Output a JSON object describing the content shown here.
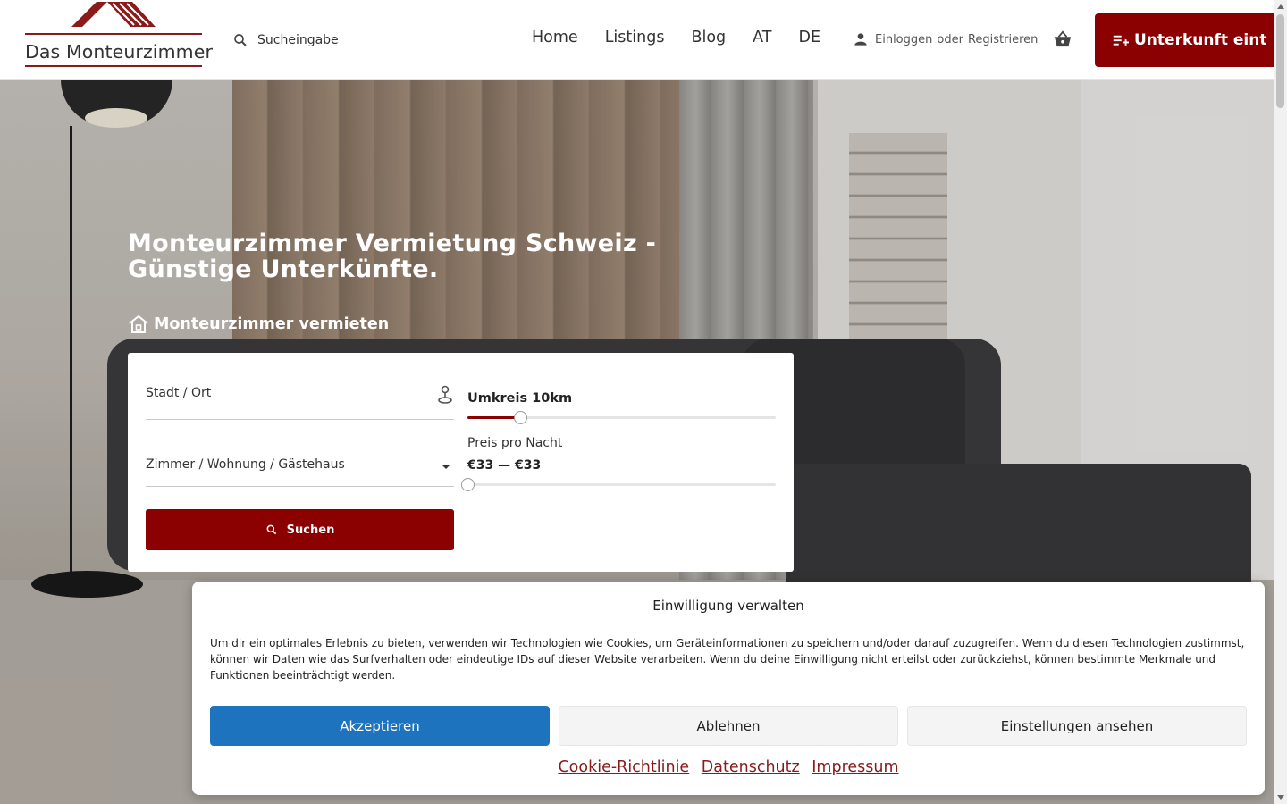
{
  "header": {
    "logo_text": "Das Monteurzimmer",
    "search_placeholder": "Sucheingabe",
    "nav": [
      "Home",
      "Listings",
      "Blog",
      "AT",
      "DE"
    ],
    "login": "Einloggen",
    "or": "oder",
    "register": "Registrieren",
    "cta": "Unterkunft eint"
  },
  "hero": {
    "title": "Monteurzimmer Vermietung Schweiz - Günstige Unterkünfte.",
    "rent_link": "Monteurzimmer vermieten"
  },
  "search_form": {
    "city_label": "Stadt / Ort",
    "type_label": "Zimmer / Wohnung / Gästehaus",
    "radius_label": "Umkreis 10km",
    "radius_fraction": 0.17,
    "price_label": "Preis pro Nacht",
    "price_range": "€33 — €33",
    "price_fraction": 0,
    "search_button": "Suchen"
  },
  "consent": {
    "title": "Einwilligung verwalten",
    "text": "Um dir ein optimales Erlebnis zu bieten, verwenden wir Technologien wie Cookies, um Geräteinformationen zu speichern und/oder darauf zuzugreifen. Wenn du diesen Technologien zustimmst, können wir Daten wie das Surfverhalten oder eindeutige IDs auf dieser Website verarbeiten. Wenn du deine Einwilligung nicht erteilst oder zurückziehst, können bestimmte Merkmale und Funktionen beeinträchtigt werden.",
    "accept": "Akzeptieren",
    "deny": "Ablehnen",
    "settings": "Einstellungen ansehen",
    "links": [
      "Cookie-Richtlinie",
      "Datenschutz",
      "Impressum"
    ]
  },
  "colors": {
    "brand": "#8b0000",
    "accept": "#1e73be"
  },
  "icons": [
    "house-roof-logo",
    "search-icon",
    "user-icon",
    "basket-icon",
    "playlist-add-icon",
    "house-icon",
    "location-pin-icon",
    "chevron-down-icon"
  ]
}
